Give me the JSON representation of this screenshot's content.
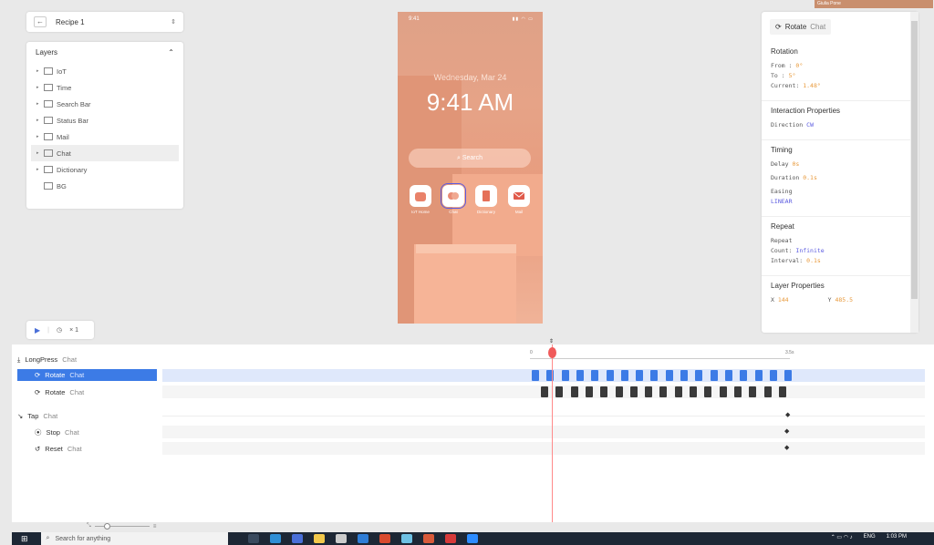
{
  "recipe": {
    "back_icon": "arrow-left-icon",
    "name": "Recipe 1",
    "updown_icon": "updown-icon"
  },
  "layers": {
    "title": "Layers",
    "items": [
      {
        "label": "IoT"
      },
      {
        "label": "Time"
      },
      {
        "label": "Search Bar"
      },
      {
        "label": "Status Bar"
      },
      {
        "label": "Mail"
      },
      {
        "label": "Chat"
      },
      {
        "label": "Dictionary"
      },
      {
        "label": "BG"
      }
    ]
  },
  "phone": {
    "status_time": "9:41",
    "date": "Wednesday, Mar 24",
    "clock": "9:41 AM",
    "search": "Search",
    "apps": [
      {
        "label": "IoT Home",
        "color": "#e9826a"
      },
      {
        "label": "Chat",
        "color": "#e98c74"
      },
      {
        "label": "Dictionary",
        "color": "#e57058"
      },
      {
        "label": "Mail",
        "color": "#e05b4c"
      }
    ]
  },
  "props": {
    "title": "Rotate",
    "title_sub": "Chat",
    "rotation": {
      "heading": "Rotation",
      "from_label": "From   :",
      "from": "0°",
      "to_label": "To     :",
      "to": "5°",
      "current_label": "Current:",
      "current": "1.48°"
    },
    "interaction": {
      "heading": "Interaction Properties",
      "direction_label": "Direction",
      "direction": "CW"
    },
    "timing": {
      "heading": "Timing",
      "delay_label": "Delay",
      "delay": "0s",
      "duration_label": "Duration",
      "duration": "0.1s",
      "easing_label": "Easing",
      "easing": "LINEAR"
    },
    "repeat": {
      "heading": "Repeat",
      "repeat_label": "Repeat",
      "count_label": "Count:",
      "count": "Infinite",
      "interval_label": "Interval:",
      "interval": "0.1s"
    },
    "layer": {
      "heading": "Layer Properties",
      "x_label": "X",
      "x": "144",
      "y_label": "Y",
      "y": "485.5"
    }
  },
  "play": {
    "repeat": "× 1"
  },
  "timeline": {
    "ruler_start": "0",
    "ruler_end": "3.5s",
    "tracks": [
      {
        "label": "LongPress",
        "sub": "Chat"
      },
      {
        "label": "Rotate",
        "sub": "Chat"
      },
      {
        "label": "Rotate",
        "sub": "Chat"
      },
      {
        "label": "Tap",
        "sub": "Chat"
      },
      {
        "label": "Stop",
        "sub": "Chat"
      },
      {
        "label": "Reset",
        "sub": "Chat"
      }
    ],
    "blue_color": "#3c7be6",
    "dark_color": "#3a3a3a"
  },
  "avatar": {
    "name": "Giulia Pone"
  },
  "taskbar": {
    "search_placeholder": "Search for anything",
    "lang": "ENG",
    "time": "1:03 PM"
  }
}
